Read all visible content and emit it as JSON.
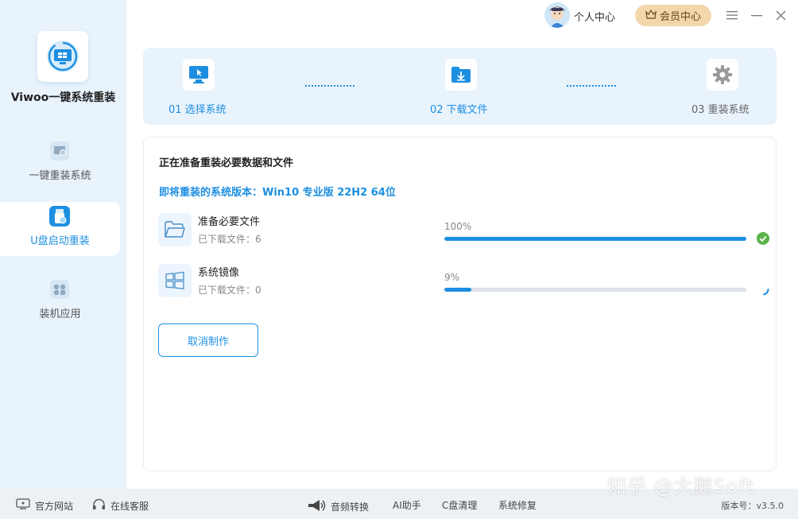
{
  "app": {
    "name": "Viwoo一键系统重装"
  },
  "sidebar": {
    "items": [
      {
        "label": "一键重装系统",
        "active": false
      },
      {
        "label": "U盘启动重装",
        "active": true
      },
      {
        "label": "装机应用",
        "active": false
      }
    ]
  },
  "topbar": {
    "user_center": "个人中心",
    "vip_center": "会员中心"
  },
  "steps": [
    {
      "label": "01 选择系统",
      "color": "#1d8fe1"
    },
    {
      "label": "02 下载文件",
      "color": "#1d8fe1"
    },
    {
      "label": "03 重装系统",
      "color": "#666666"
    }
  ],
  "main": {
    "title": "正在准备重装必要数据和文件",
    "version_line": "即将重装的系统版本：Win10 专业版 22H2 64位",
    "tasks": [
      {
        "name": "准备必要文件",
        "count": "已下载文件：6",
        "percent_label": "100%",
        "progress": 1.0,
        "status": "done"
      },
      {
        "name": "系统镜像",
        "count": "已下载文件：0",
        "percent_label": "9%",
        "progress": 0.09,
        "status": "loading"
      }
    ],
    "cancel_label": "取消制作"
  },
  "bottom": {
    "website": "官方网站",
    "service": "在线客服",
    "audio": "音频转换",
    "ai": "AI助手",
    "cclean": "C盘清理",
    "repair": "系统修复",
    "version": "版本号：v3.5.0"
  },
  "watermark": "知乎 @大鹅Soft",
  "colors": {
    "accent": "#1d8fe1",
    "sidebar_bg": "#e9f3fc",
    "success": "#5ab34a",
    "vip": "#f2d7ad"
  }
}
